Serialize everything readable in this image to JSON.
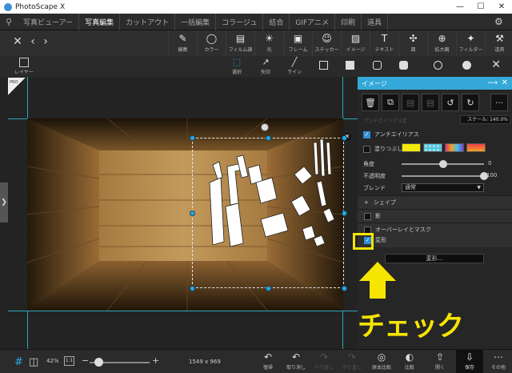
{
  "window": {
    "title": "PhotoScape X",
    "controls": [
      "—",
      "☐",
      "✕"
    ]
  },
  "main_tabs": [
    "写真ビューアー",
    "写真編集",
    "カットアウト",
    "一括編集",
    "コラージュ",
    "結合",
    "GIFアニメ",
    "印刷",
    "道具"
  ],
  "active_tab": "写真編集",
  "toolbar": {
    "tools": [
      {
        "icon": "edit-icon",
        "label": "編集"
      },
      {
        "icon": "color-icon",
        "label": "カラー"
      },
      {
        "icon": "film-icon",
        "label": "フィルム調"
      },
      {
        "icon": "light-icon",
        "label": "光"
      },
      {
        "icon": "frame-icon",
        "label": "フレーム"
      },
      {
        "icon": "sticker-icon",
        "label": "ステッカー"
      },
      {
        "icon": "image-icon",
        "label": "イメージ"
      },
      {
        "icon": "text-icon",
        "label": "テキスト"
      },
      {
        "icon": "figure-icon",
        "label": "図"
      },
      {
        "icon": "magnifier-icon",
        "label": "拡大鏡"
      },
      {
        "icon": "filter-icon",
        "label": "フィルター"
      },
      {
        "icon": "tools-icon",
        "label": "道具"
      }
    ]
  },
  "toolbar2": {
    "layer_label": "レイヤー",
    "select_label": "選択",
    "arrow_label": "矢印",
    "line_label": "ライン"
  },
  "canvas": {
    "pro_badge": "PRO"
  },
  "panel": {
    "title": "イメージ",
    "scale_text": "スケール: 140.0%",
    "faint_text": "アンチエイリアス定",
    "antialias_label": "アンチエイリアス",
    "antialias_checked": true,
    "fill_label": "塗りつぶし",
    "fill_checked": false,
    "angle_label": "角度",
    "angle_value": "0",
    "angle_level_percent": 50,
    "opacity_label": "不透明度",
    "opacity_value": "100",
    "opacity_level_percent": 100,
    "blend_label": "ブレンド",
    "blend_value": "通常",
    "shadow_label": "シェイプ",
    "shadow_expand": "+",
    "shadow2_label": "影",
    "outline_label": "オーバーレイとマスク",
    "transform_label": "変形",
    "transform_checked": true,
    "transform_button": "変形..."
  },
  "annotation": {
    "text": "チェック",
    "color": "#f5e500"
  },
  "bottombar": {
    "zoom": "42%",
    "one_to_one": "1:1",
    "dimensions": "1549 x 969",
    "buttons": [
      {
        "icon": "undo-icon",
        "label": "復帰",
        "enabled": true
      },
      {
        "icon": "undo-icon",
        "label": "取り消し",
        "enabled": true
      },
      {
        "icon": "redo-icon",
        "label": "やり直し",
        "enabled": false
      },
      {
        "icon": "redo-icon",
        "label": "やり直し",
        "enabled": false
      },
      {
        "icon": "compare-icon",
        "label": "原本比較",
        "enabled": true
      },
      {
        "icon": "compare-icon",
        "label": "比較",
        "enabled": true
      },
      {
        "icon": "open-icon",
        "label": "開く",
        "enabled": true
      }
    ],
    "save_label": "保存",
    "more_label": "その他"
  }
}
